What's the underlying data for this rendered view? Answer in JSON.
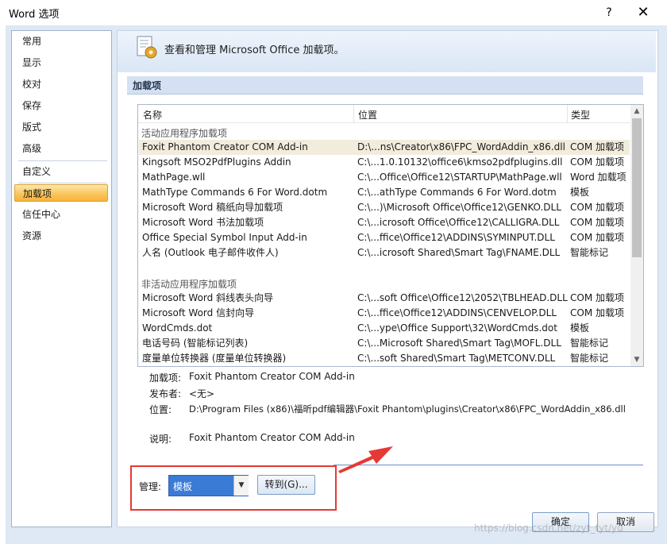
{
  "window": {
    "title": "Word 选项",
    "help": "?",
    "close": "✕"
  },
  "nav": {
    "items": [
      {
        "label": "常用"
      },
      {
        "label": "显示"
      },
      {
        "label": "校对"
      },
      {
        "label": "保存"
      },
      {
        "label": "版式"
      },
      {
        "label": "高级"
      },
      {
        "label": "自定义"
      },
      {
        "label": "加载项"
      },
      {
        "label": "信任中心"
      },
      {
        "label": "资源"
      }
    ],
    "selected": "加载项"
  },
  "header": {
    "text": "查看和管理 Microsoft Office 加载项。"
  },
  "section": {
    "title": "加载项"
  },
  "list": {
    "columns": [
      "名称",
      "位置",
      "类型"
    ],
    "active_group": "活动应用程序加载项",
    "active_rows": [
      {
        "name": "Foxit Phantom Creator COM Add-in",
        "location": "D:\\...ns\\Creator\\x86\\FPC_WordAddin_x86.dll",
        "type": "COM 加载项"
      },
      {
        "name": "Kingsoft MSO2PdfPlugins Addin",
        "location": "C:\\...1.0.10132\\office6\\kmso2pdfplugins.dll",
        "type": "COM 加载项"
      },
      {
        "name": "MathPage.wll",
        "location": "C:\\...Office\\Office12\\STARTUP\\MathPage.wll",
        "type": "Word 加载项"
      },
      {
        "name": "MathType Commands 6 For Word.dotm",
        "location": "C:\\...athType Commands 6 For Word.dotm",
        "type": "模板"
      },
      {
        "name": "Microsoft Word 稿纸向导加载项",
        "location": "C:\\...)\\Microsoft Office\\Office12\\GENKO.DLL",
        "type": "COM 加载项"
      },
      {
        "name": "Microsoft Word 书法加载项",
        "location": "C:\\...icrosoft Office\\Office12\\CALLIGRA.DLL",
        "type": "COM 加载项"
      },
      {
        "name": "Office Special Symbol Input Add-in",
        "location": "C:\\...ffice\\Office12\\ADDINS\\SYMINPUT.DLL",
        "type": "COM 加载项"
      },
      {
        "name": "人名 (Outlook 电子邮件收件人)",
        "location": "C:\\...icrosoft Shared\\Smart Tag\\FNAME.DLL",
        "type": "智能标记"
      }
    ],
    "inactive_group": "非活动应用程序加载项",
    "inactive_rows": [
      {
        "name": "Microsoft Word 斜线表头向导",
        "location": "C:\\...soft Office\\Office12\\2052\\TBLHEAD.DLL",
        "type": "COM 加载项"
      },
      {
        "name": "Microsoft Word 信封向导",
        "location": "C:\\...ffice\\Office12\\ADDINS\\CENVELOP.DLL",
        "type": "COM 加载项"
      },
      {
        "name": "WordCmds.dot",
        "location": "C:\\...ype\\Office Support\\32\\WordCmds.dot",
        "type": "模板"
      },
      {
        "name": "电话号码 (智能标记列表)",
        "location": "C:\\...Microsoft Shared\\Smart Tag\\MOFL.DLL",
        "type": "智能标记"
      },
      {
        "name": "度量单位转换器 (度量单位转换器)",
        "location": "C:\\...soft Shared\\Smart Tag\\METCONV.DLL",
        "type": "智能标记"
      }
    ]
  },
  "details": {
    "addin_label": "加载项:",
    "addin_value": "Foxit Phantom Creator COM Add-in",
    "publisher_label": "发布者:",
    "publisher_value": "<无>",
    "location_label": "位置:",
    "location_value": "D:\\Program Files (x86)\\福昕pdf编辑器\\Foxit Phantom\\plugins\\Creator\\x86\\FPC_WordAddin_x86.dll",
    "desc_label": "说明:",
    "desc_value": "Foxit Phantom Creator COM Add-in"
  },
  "manage": {
    "label": "管理:",
    "selected": "模板",
    "go_button": "转到(G)..."
  },
  "buttons": {
    "ok": "确定",
    "cancel": "取消"
  },
  "watermark": "https://blog.csdn.net/zyt_tyt/yu",
  "colors": {
    "highlight_box": "#e53935",
    "selected_nav": "#f9c75e",
    "select_bg": "#3a7bd5"
  }
}
